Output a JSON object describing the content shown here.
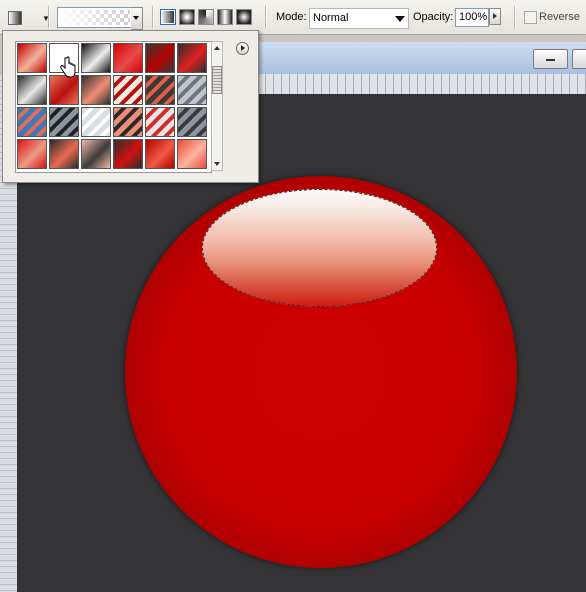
{
  "options_bar": {
    "mode_label": "Mode:",
    "mode_value": "Normal",
    "opacity_label": "Opacity:",
    "opacity_value": "100%",
    "reverse_label": "Reverse",
    "reverse_checked": false,
    "gradient_types": [
      "linear",
      "radial",
      "angle",
      "reflected",
      "diamond"
    ],
    "active_gradient_type": "linear"
  },
  "preset_panel": {
    "columns": 6,
    "presets": [
      {
        "a": "#c00000",
        "b": "#f5b39c",
        "style": "diag"
      },
      {
        "a": "#ffffff",
        "b": "#ffffff",
        "style": "solid"
      },
      {
        "a": "#111111",
        "b": "#f0f0f0",
        "style": "diag"
      },
      {
        "a": "#d40000",
        "b": "#e84d4d",
        "style": "diag"
      },
      {
        "a": "#3a3a3a",
        "b": "#b30000",
        "style": "diag"
      },
      {
        "a": "#2d2d2d",
        "b": "#e02020",
        "style": "diag"
      },
      {
        "a": "#2a2a2a",
        "b": "#e8e8e8",
        "style": "diag"
      },
      {
        "a": "#e8765a",
        "b": "#b81010",
        "style": "diag"
      },
      {
        "a": "#303030",
        "b": "#ef8d73",
        "style": "diag"
      },
      {
        "a": "#fbe8e0",
        "b": "#b3110f",
        "style": "stripes"
      },
      {
        "a": "#3a3a3a",
        "b": "#e45f45",
        "style": "stripes"
      },
      {
        "a": "#c2c5ca",
        "b": "#6d7582",
        "style": "stripes"
      },
      {
        "a": "#3a7ab9",
        "b": "#e96a52",
        "style": "stripes"
      },
      {
        "a": "#8c96a3",
        "b": "#222222",
        "style": "stripes"
      },
      {
        "a": "#d8dde2",
        "b": "#ffffff",
        "style": "stripes"
      },
      {
        "a": "#ef8e76",
        "b": "#2a2a2a",
        "style": "stripes"
      },
      {
        "a": "#e2e6ea",
        "b": "#d72b24",
        "style": "stripes"
      },
      {
        "a": "#8d95a1",
        "b": "#3a3a3a",
        "style": "stripes"
      },
      {
        "a": "#d61414",
        "b": "#eb9a86",
        "style": "diag"
      },
      {
        "a": "#2b2b2b",
        "b": "#ea6a52",
        "style": "diag"
      },
      {
        "a": "#f2b7a6",
        "b": "#3b3b3b",
        "style": "diag"
      },
      {
        "a": "#2f2f2f",
        "b": "#d01010",
        "style": "diag"
      },
      {
        "a": "#b00000",
        "b": "#f05a45",
        "style": "diag"
      },
      {
        "a": "#ea4a35",
        "b": "#ffb3a3",
        "style": "diag"
      }
    ]
  }
}
